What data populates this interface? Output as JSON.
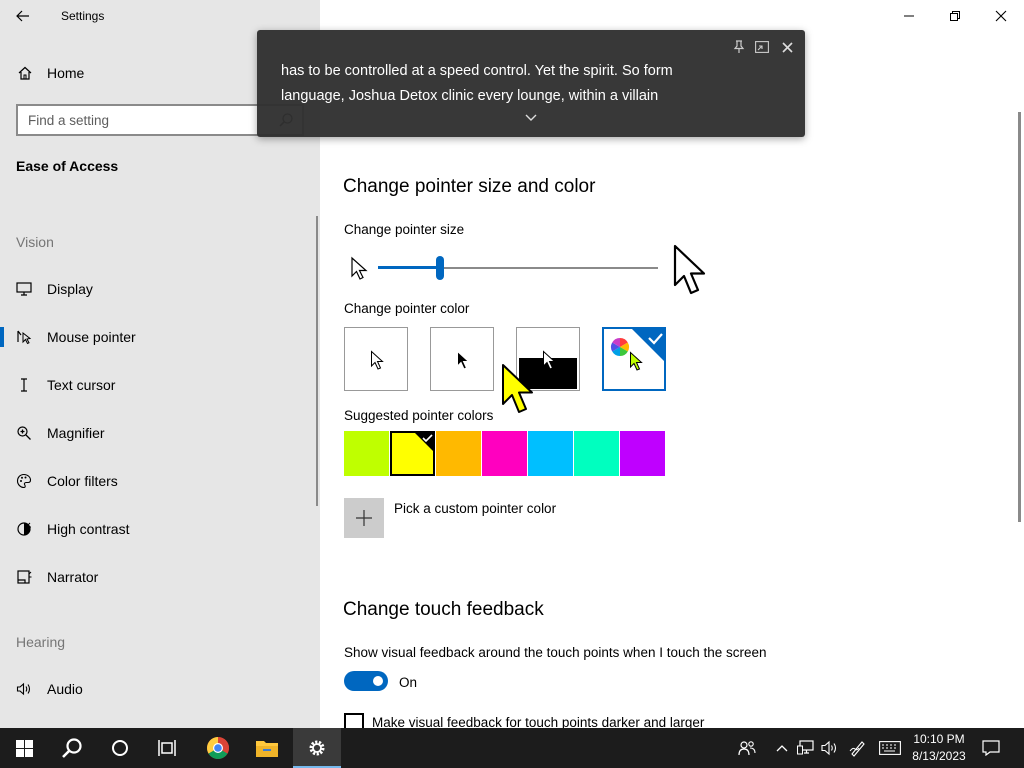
{
  "window": {
    "app_title": "Settings"
  },
  "sidebar": {
    "home_label": "Home",
    "search_placeholder": "Find a setting",
    "section_title": "Ease of Access",
    "groups": {
      "vision": "Vision",
      "hearing": "Hearing"
    },
    "items": [
      {
        "label": "Display",
        "icon": "display-icon"
      },
      {
        "label": "Mouse pointer",
        "icon": "mouse-pointer-icon",
        "active": true
      },
      {
        "label": "Text cursor",
        "icon": "text-cursor-icon"
      },
      {
        "label": "Magnifier",
        "icon": "magnifier-icon"
      },
      {
        "label": "Color filters",
        "icon": "color-filters-icon"
      },
      {
        "label": "High contrast",
        "icon": "high-contrast-icon"
      },
      {
        "label": "Narrator",
        "icon": "narrator-icon"
      },
      {
        "label": "Audio",
        "icon": "audio-icon"
      }
    ]
  },
  "caption": {
    "line1": "has to be controlled at a speed control. Yet the spirit. So form",
    "line2": "language, Joshua Detox clinic every lounge, within a villain"
  },
  "main": {
    "pointer_section": {
      "title": "Change pointer size and color",
      "size_label": "Change pointer size",
      "size_level": 0.22,
      "color_label": "Change pointer color",
      "color_options": [
        "white",
        "black",
        "inverted",
        "custom"
      ],
      "selected_color_option": "custom",
      "suggested_label": "Suggested pointer colors",
      "suggested_colors": [
        "#bfff00",
        "#ffff00",
        "#ffb900",
        "#ff00bf",
        "#00bfff",
        "#00ffbf",
        "#bf00ff"
      ],
      "selected_suggested_index": 1,
      "custom_label": "Pick a custom pointer color"
    },
    "touch_section": {
      "title": "Change touch feedback",
      "feedback_label": "Show visual feedback around the touch points when I touch the screen",
      "toggle_state": "On",
      "darker_label": "Make visual feedback for touch points darker and larger"
    }
  },
  "taskbar": {
    "apps": [
      "start-icon",
      "search-icon",
      "cortana-icon",
      "task-view-icon",
      "chrome-icon",
      "file-explorer-icon",
      "settings-icon"
    ],
    "time": "10:10 PM",
    "date": "8/13/2023"
  },
  "colors": {
    "accent": "#0067c0",
    "sidebar_bg": "#e6e6e6",
    "taskbar_bg": "#1c1c1c",
    "pointer_yellow": "#ffff00"
  }
}
